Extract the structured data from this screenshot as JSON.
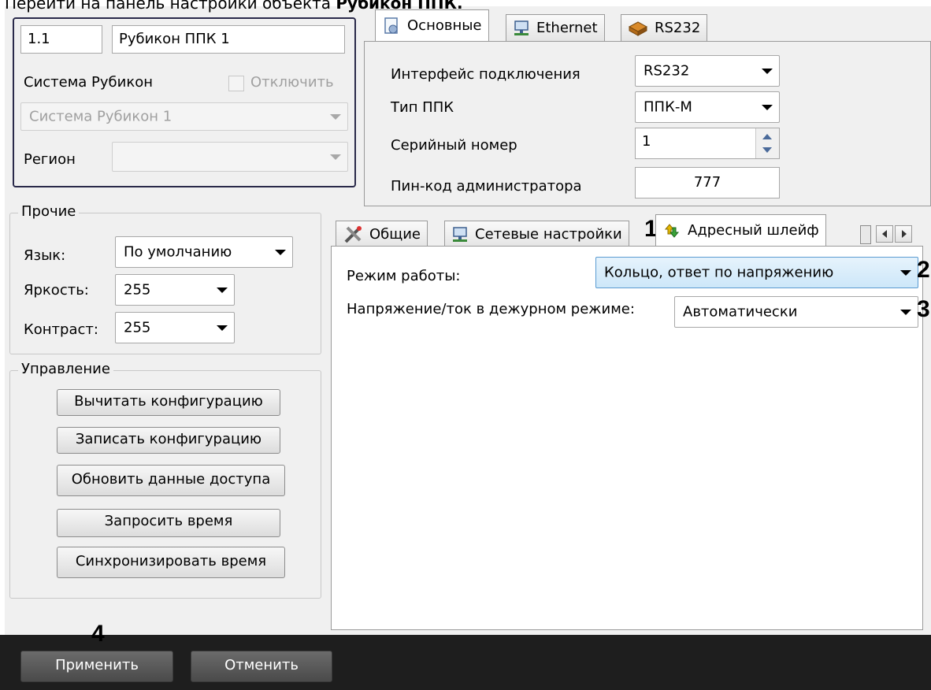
{
  "caption": {
    "prefix": "Перейти на панель настройки объекта ",
    "bold": "Рубикон ППК."
  },
  "object": {
    "id_value": "1.1",
    "name_value": "Рубикон ППК 1",
    "system_label": "Система Рубикон",
    "disable_label": "Отключить",
    "system_value": "Система Рубикон 1",
    "region_label": "Регион",
    "region_value": ""
  },
  "top_tabs": [
    {
      "label": "Основные",
      "icon": "settings-page-icon",
      "active": true
    },
    {
      "label": "Ethernet",
      "icon": "network-icon",
      "active": false
    },
    {
      "label": "RS232",
      "icon": "serial-port-icon",
      "active": false
    }
  ],
  "main": {
    "interface_label": "Интерфейс подключения",
    "interface_value": "RS232",
    "ppk_type_label": "Тип ППК",
    "ppk_type_value": "ППК-М",
    "serial_label": "Серийный номер",
    "serial_value": "1",
    "pin_label": "Пин-код администратора",
    "pin_value": "777"
  },
  "other": {
    "title": "Прочие",
    "language_label": "Язык:",
    "language_value": "По умолчанию",
    "brightness_label": "Яркость:",
    "brightness_value": "255",
    "contrast_label": "Контраст:",
    "contrast_value": "255"
  },
  "control": {
    "title": "Управление",
    "buttons": [
      "Вычитать конфигурацию",
      "Записать конфигурацию",
      "Обновить данные доступа",
      "Запросить время",
      "Синхронизировать время"
    ]
  },
  "bottom_tabs": [
    {
      "label": "Общие",
      "icon": "tools-icon",
      "active": false
    },
    {
      "label": "Сетевые настройки",
      "icon": "network-icon",
      "active": false
    },
    {
      "label": "Адресный шлейф",
      "icon": "address-loop-icon",
      "active": true
    }
  ],
  "loop": {
    "mode_label": "Режим работы:",
    "mode_value": "Кольцо, ответ по напряжению",
    "standby_label": "Напряжение/ток в дежурном режиме:",
    "standby_value": "Автоматически"
  },
  "markers": {
    "m1": "1",
    "m2": "2",
    "m3": "3",
    "m4": "4"
  },
  "footer": {
    "apply": "Применить",
    "cancel": "Отменить"
  },
  "colors": {
    "window_bg": "#f0f0f0",
    "footer_bg": "#1e1e1e",
    "highlight": "#cde7f9",
    "frame": "#2a2a4a"
  }
}
